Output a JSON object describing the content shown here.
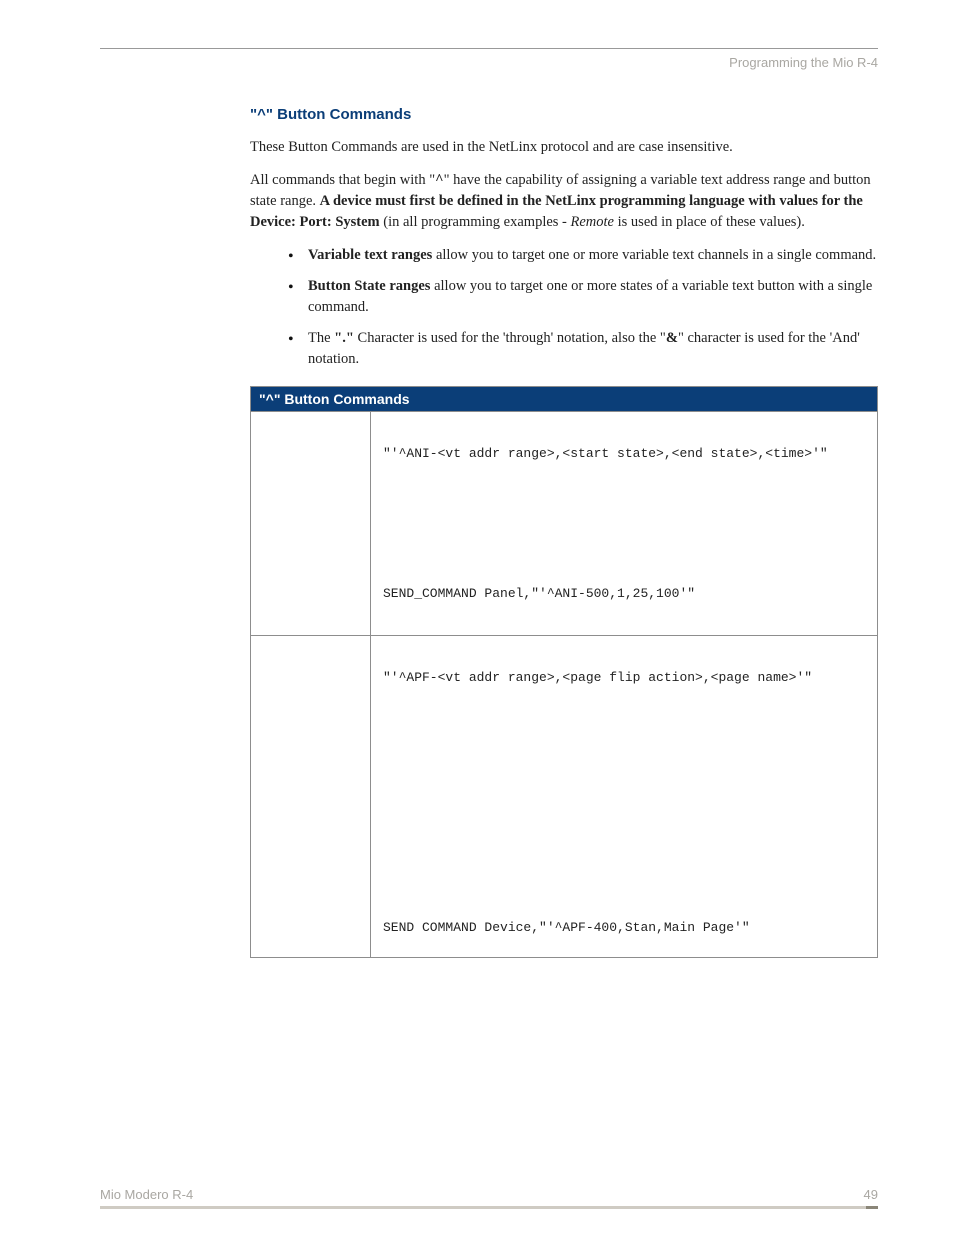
{
  "header": {
    "right": "Programming the Mio R-4"
  },
  "section": {
    "title": "\"^\" Button Commands",
    "p1": "These Button Commands are used in the NetLinx protocol and are case insensitive.",
    "p2_a": "All commands that begin with \"",
    "p2_b": "^",
    "p2_c": "\" have the capability of assigning a variable text address range and button state range. ",
    "p2_bold": "A device must first be defined in the NetLinx programming language with values for the Device: Port: System",
    "p2_d": " (in all programming examples - ",
    "p2_italic": "Remote",
    "p2_e": " is used in place of these values).",
    "bullets": {
      "b1_bold": "Variable text ranges",
      "b1_rest": " allow you to target one or more variable text channels in a single command.",
      "b2_bold": "Button State ranges",
      "b2_rest": " allow you to target one or more states of a variable text button with a single command.",
      "b3_a": "The ",
      "b3_bold1": "\".\"",
      "b3_b": " Character is used for the 'through' notation, also the \"",
      "b3_bold2": "&",
      "b3_c": "\" character is used for the 'And' notation."
    }
  },
  "table": {
    "header": "\"^\" Button Commands",
    "rows": [
      {
        "syntax": "\"'^ANI-<vt addr range>,<start state>,<end state>,<time>'\"",
        "example": "SEND_COMMAND Panel,\"'^ANI-500,1,25,100'\""
      },
      {
        "syntax": "\"'^APF-<vt addr range>,<page flip action>,<page name>'\"",
        "example": "SEND COMMAND Device,\"'^APF-400,Stan,Main Page'\""
      }
    ]
  },
  "footer": {
    "left": "Mio Modero R-4",
    "right": "49"
  }
}
